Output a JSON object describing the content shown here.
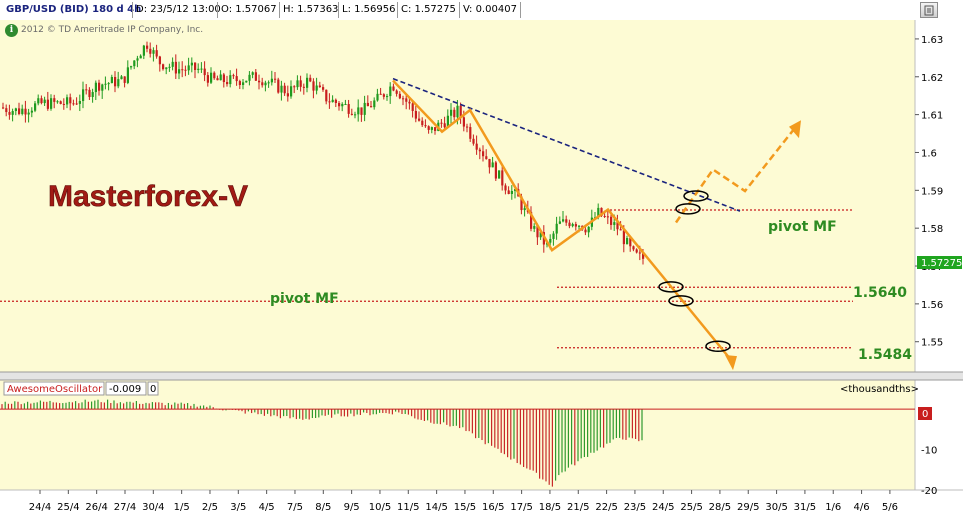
{
  "header": {
    "symbol": "GBP/USD (BID) 180 d 4h",
    "date": "D: 23/5/12 13:00",
    "open": "O: 1.57067",
    "high": "H: 1.57363",
    "low": "L: 1.56956",
    "close": "C: 1.57275",
    "volume": "V: 0.00407"
  },
  "copyright": "2012 © TD Ameritrade IP Company, Inc.",
  "info_icon": "i",
  "watermark": "Masterforex-V",
  "colors": {
    "background": "#fdfbd4",
    "up_candle": "#1f9a1f",
    "down_candle": "#c81e1e",
    "trend_line": "#f29a1e",
    "dashed_trend": "#1a237e",
    "pivot_line": "#c81e1e",
    "pivot_text": "#2e8b22",
    "watermark": "#a11a14",
    "ao_up": "#2e9a2e",
    "ao_down": "#c82a2a"
  },
  "chart_data": {
    "type": "candlestick",
    "title": "GBP/USD (BID) 180 d 4h",
    "ylim": [
      1.542,
      1.635
    ],
    "y_ticks": [
      "1.63",
      "1.62",
      "1.61",
      "1.6",
      "1.59",
      "1.58",
      "1.57",
      "1.56",
      "1.55"
    ],
    "current_price": "1.57275",
    "x_ticks": [
      "24/4",
      "25/4",
      "26/4",
      "27/4",
      "30/4",
      "1/5",
      "2/5",
      "3/5",
      "4/5",
      "7/5",
      "8/5",
      "9/5",
      "10/5",
      "11/5",
      "14/5",
      "15/5",
      "16/5",
      "17/5",
      "18/5",
      "21/5",
      "22/5",
      "23/5",
      "24/5",
      "25/5",
      "28/5",
      "29/5",
      "30/5",
      "31/5",
      "1/6",
      "4/6",
      "5/6"
    ],
    "annotations": [
      {
        "text": "pivot MF",
        "price": 1.5607
      },
      {
        "text": "pivot MF",
        "price": 1.5848
      },
      {
        "text": "1.5640",
        "price": 1.5644
      },
      {
        "text": "1.5484",
        "price": 1.5484
      }
    ],
    "pivot_levels": [
      1.5848,
      1.5644,
      1.5607,
      1.5484
    ]
  },
  "oscillator": {
    "name": "AwesomeOscillator",
    "value": "-0.009",
    "extra": "0",
    "units": "<thousandths>",
    "ylim": [
      -20,
      3
    ],
    "y_ticks": [
      "-10",
      "-20"
    ],
    "zero_label": "0"
  }
}
